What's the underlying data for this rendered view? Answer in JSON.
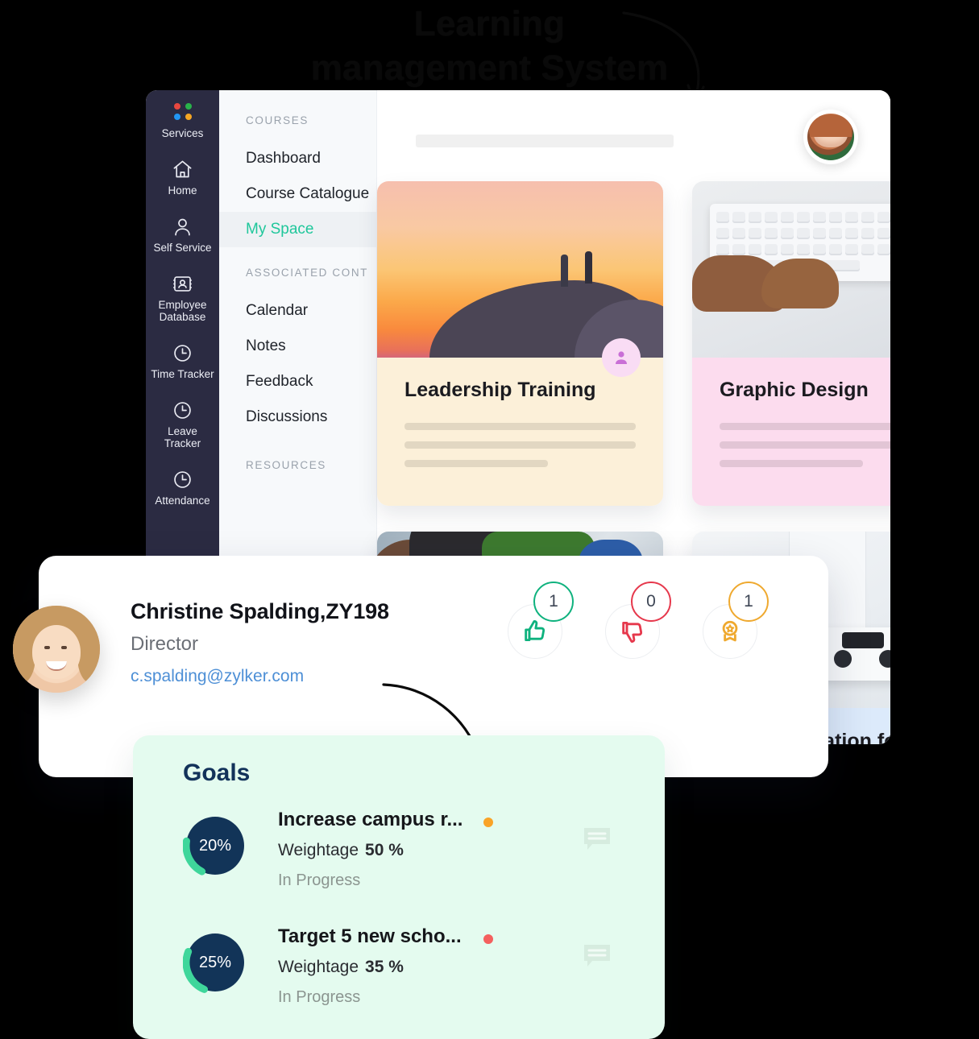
{
  "headline": {
    "line1": "Learning",
    "line2": "management System"
  },
  "rail": {
    "items": [
      {
        "label": "Services",
        "icon": "grid-dots-icon"
      },
      {
        "label": "Home",
        "icon": "home-icon"
      },
      {
        "label": "Self Service",
        "icon": "person-icon"
      },
      {
        "label": "Employee Database",
        "icon": "id-card-icon"
      },
      {
        "label": "Time Tracker",
        "icon": "clock-icon"
      },
      {
        "label": "Leave Tracker",
        "icon": "clock-icon"
      },
      {
        "label": "Attendance",
        "icon": "clock-icon"
      }
    ]
  },
  "subnav": {
    "section_courses": "COURSES",
    "courses": [
      {
        "label": "Dashboard",
        "active": false
      },
      {
        "label": "Course Catalogue",
        "active": false
      },
      {
        "label": "My Space",
        "active": true
      }
    ],
    "section_associated": "ASSOCIATED CONT",
    "associated": [
      {
        "label": "Calendar"
      },
      {
        "label": "Notes"
      },
      {
        "label": "Feedback"
      },
      {
        "label": "Discussions"
      }
    ],
    "section_resources": "RESOURCES"
  },
  "cards": [
    {
      "title": "Leadership Training",
      "bg": "#fcf0d9",
      "badge_bg": "#f7daf2",
      "badge_fg": "#c468cf",
      "photo": "sunset-hikers-photo"
    },
    {
      "title": "Graphic Design",
      "bg": "#fcdcee",
      "badge_bg": "#fbdfa6",
      "badge_fg": "#d09a33",
      "photo": "keyboard-hands-photo"
    },
    {
      "title": "",
      "bg": "#ffffff",
      "badge_bg": "#e4eefb",
      "badge_fg": "#8ab3e0",
      "photo": "misc-photo"
    },
    {
      "title": "Communication for Better Pro..",
      "bg": "#dceafb",
      "badge_bg": "#cfe2f7",
      "badge_fg": "#8db4dd",
      "photo": "playstation-photo"
    }
  ],
  "profile": {
    "name": "Christine Spalding,ZY198",
    "role": "Director",
    "email": "c.spalding@zylker.com",
    "avatar": "christine-avatar",
    "reactions": [
      {
        "name": "thumbs-up",
        "count": "1",
        "color": "#0fb27e"
      },
      {
        "name": "thumbs-down",
        "count": "0",
        "color": "#e6384c"
      },
      {
        "name": "award",
        "count": "1",
        "color": "#efa92f"
      }
    ]
  },
  "goals": {
    "title": "Goals",
    "weightage_label": "Weightage",
    "items": [
      {
        "progress_label": "20%",
        "progress": 20,
        "name": "Increase campus r...",
        "weightage": "50 %",
        "status": "In Progress",
        "dot_color": "#f9a327"
      },
      {
        "progress_label": "25%",
        "progress": 25,
        "name": "Target 5 new scho...",
        "weightage": "35 %",
        "status": "In Progress",
        "dot_color": "#f4605e"
      }
    ]
  },
  "colors": {
    "rail_bg": "#2b2b42",
    "accent_green": "#1fc79b",
    "goals_bg": "#e4fbef",
    "donut_track": "#123458",
    "donut_fill": "#3fd69b"
  }
}
